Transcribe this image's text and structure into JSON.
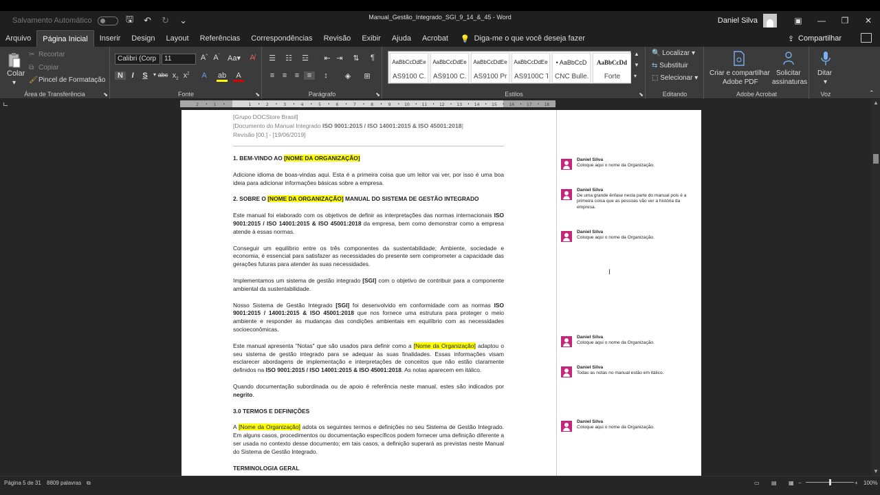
{
  "titlebar": {
    "autosave_label": "Salvamento Automático",
    "document_title": "Manual_Gestão_Integrado_SGI_9_14_&_45 - Word",
    "user_name": "Daniel Silva"
  },
  "menu": {
    "tabs": [
      "Arquivo",
      "Página Inicial",
      "Inserir",
      "Design",
      "Layout",
      "Referências",
      "Correspondências",
      "Revisão",
      "Exibir",
      "Ajuda",
      "Acrobat"
    ],
    "active_tab": "Página Inicial",
    "tell_me": "Diga-me o que você deseja fazer",
    "share": "Compartilhar"
  },
  "ribbon": {
    "clipboard": {
      "paste": "Colar",
      "cut": "Recortar",
      "copy": "Copiar",
      "format_painter": "Pincel de Formatação",
      "label": "Área de Transferência"
    },
    "font": {
      "font_name": "Calibri (Corp",
      "font_size": "11",
      "label": "Fonte"
    },
    "paragraph": {
      "label": "Parágrafo"
    },
    "styles": {
      "label": "Estilos",
      "items": [
        {
          "sample": "AaBbCcDdEe",
          "name": "AS9100 C..."
        },
        {
          "sample": "AaBbCcDdEe",
          "name": "AS9100 C..."
        },
        {
          "sample": "AaBbCcDdEe",
          "name": "AS9100 Pr..."
        },
        {
          "sample": "AaBbCcDdEe",
          "name": "AS9100C T..."
        },
        {
          "sample": "• AaBbCcD",
          "name": "CNC Bulle..."
        },
        {
          "sample": "AaBbCcDd",
          "name": "Forte"
        }
      ]
    },
    "editing": {
      "find": "Localizar",
      "replace": "Substituir",
      "select": "Selecionar",
      "label": "Editando"
    },
    "acrobat": {
      "create_share": "Criar e compartilhar",
      "create_share2": "Adobe PDF",
      "request": "Solicitar",
      "request2": "assinaturas",
      "label": "Adobe Acrobat"
    },
    "voice": {
      "dictate": "Ditar",
      "label": "Voz"
    }
  },
  "document": {
    "header": {
      "line1": "[Grupo DOCStore Brasil]",
      "line2_prefix": "[Documento do Manual Integrado ",
      "line2_bold": "ISO 9001:2015 / ISO 14001:2015 & ISO 45001:2018",
      "line2_suffix": "]",
      "line3": "Revisão [00.] - [19/06/2019]"
    },
    "s1_title": "1.  BEM-VINDO AO ",
    "org_upper": "[NOME DA ORGANIZAÇÃO]",
    "s1_text": "Adicione idioma de boas-vindas aqui. Esta é a primeira coisa que um leitor vai ver, por isso é uma boa ideia para adicionar informações básicas sobre a empresa.",
    "s2_prefix": "2. SOBRE O ",
    "s2_suffix": " MANUAL DO SISTEMA DE GESTÃO INTEGRADO",
    "p1_a": "Este manual foi elaborado com os objetivos de definir as interpretações das normas internacionais ",
    "p1_b": "ISO 9001:2015 / ISO 14001:2015 & ISO 45001:2018",
    "p1_c": " da empresa, bem como demonstrar como a empresa atende à essas normas.",
    "p2": "Conseguir um equilíbrio entre os três componentes da sustentabilidade; Ambiente, sociedade e economia, é essencial para satisfazer as necessidades do presente sem comprometer a capacidade das gerações futuras para atender às suas necessidades.",
    "p3_a": "Implementamos um sistema de gestão integrado ",
    "p3_b": "[SGI]",
    "p3_c": " com o objetivo de contribuir para a componente ambiental da sustentabilidade.",
    "p4_a": "Nosso Sistema de Gestão Integrado ",
    "p4_b": "[SGI]",
    "p4_c": " foi desenvolvido em conformidade com as normas ",
    "p4_d": "ISO 9001:2015 / 14001:2015 & ISO 45001:2018",
    "p4_e": " que nos fornece uma estrutura para proteger o meio ambiente e responder às mudanças das condições ambientais em equilíbrio com as necessidades socioeconômicas.",
    "p5_a": "Este manual apresenta \"Notas\" que são usados para definir como a ",
    "org_mixed": "[Nome da Organização]",
    "p5_c": " adaptou o seu sistema de gestão integrado para se adequar às suas finalidades. Essas informações visam esclarecer abordagens de implementação e interpretações de conceitos que não estão claramente definidos na ",
    "p5_d": "ISO 9001:2015 / ISO 14001:2015 & ISO 45001:2018",
    "p5_e": ". As notas aparecem em itálico.",
    "p6_a": "Quando documentação subordinada ou de apoio é referência neste manual, estes são indicados por ",
    "p6_b": "negrito",
    "p6_c": ".",
    "s3_title": "3.0 TERMOS E DEFINIÇÕES",
    "p7_a": "A ",
    "p7_c": " adota os seguintes termos e definições no seu Sistema de Gestão Integrado. Em alguns casos, procedimentos ou documentação específicos podem fornecer uma definição diferente a ser usada no contexto desse documento; em tais casos, a definição superará as previstas neste Manual do Sistema de Gestão Integrado.",
    "s4_title": "TERMINOLOGIA GERAL"
  },
  "comments": [
    {
      "author": "Daniel Silva",
      "text": "Coloque aqui o nome da Organização."
    },
    {
      "author": "Daniel Silva",
      "text": "De uma grande ênfase nesta parte do manual pois é a primeira coisa que as pessoas vão ver a história da empresa."
    },
    {
      "author": "Daniel Silva",
      "text": "Coloque aqui o nome da Organização."
    },
    {
      "author": "Daniel Silva",
      "text": "Coloque aqui o nome da Organização."
    },
    {
      "author": "Daniel Silva",
      "text": "Todas as notas no manual estão em itálico."
    },
    {
      "author": "Daniel Silva",
      "text": "Coloque aqui o nome da Organização."
    }
  ],
  "status": {
    "page": "Página 5 de 31",
    "words": "8809 palavras",
    "zoom": "100%"
  }
}
